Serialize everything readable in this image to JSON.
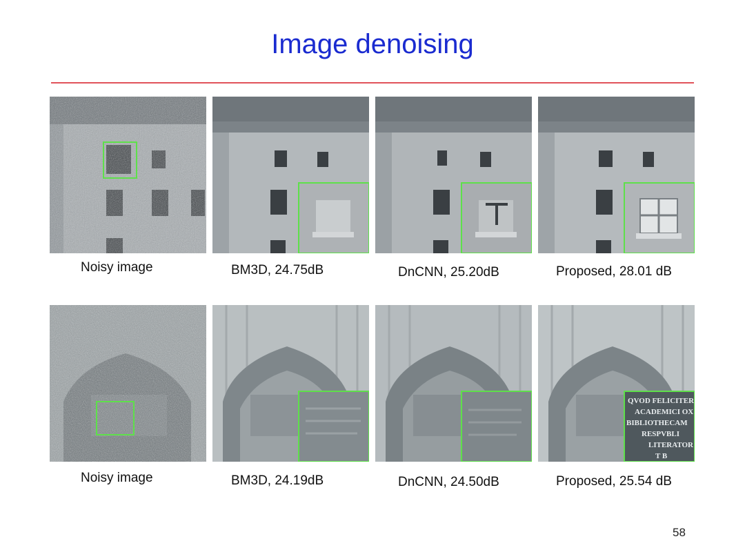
{
  "slide": {
    "title": "Image denoising",
    "page_number": "58",
    "accent_color": "#e0525a",
    "title_color": "#1a2bd0",
    "inset_border_color": "#5ee04a"
  },
  "rows": [
    {
      "scene": "building facade with windows",
      "captions": [
        "Noisy image",
        "BM3D, 24.75dB",
        "DnCNN, 25.20dB",
        "Proposed, 28.01 dB"
      ]
    },
    {
      "scene": "ornate stone arch with inscription",
      "captions": [
        "Noisy image",
        "BM3D, 24.19dB",
        "DnCNN, 24.50dB",
        "Proposed, 25.54 dB"
      ],
      "inset_text": [
        "QVOD FELICITER",
        "ACADEMICI OX",
        "BIBLIOTHECAM",
        "RESPVBLI",
        "LITERATOR",
        "T B"
      ]
    }
  ]
}
